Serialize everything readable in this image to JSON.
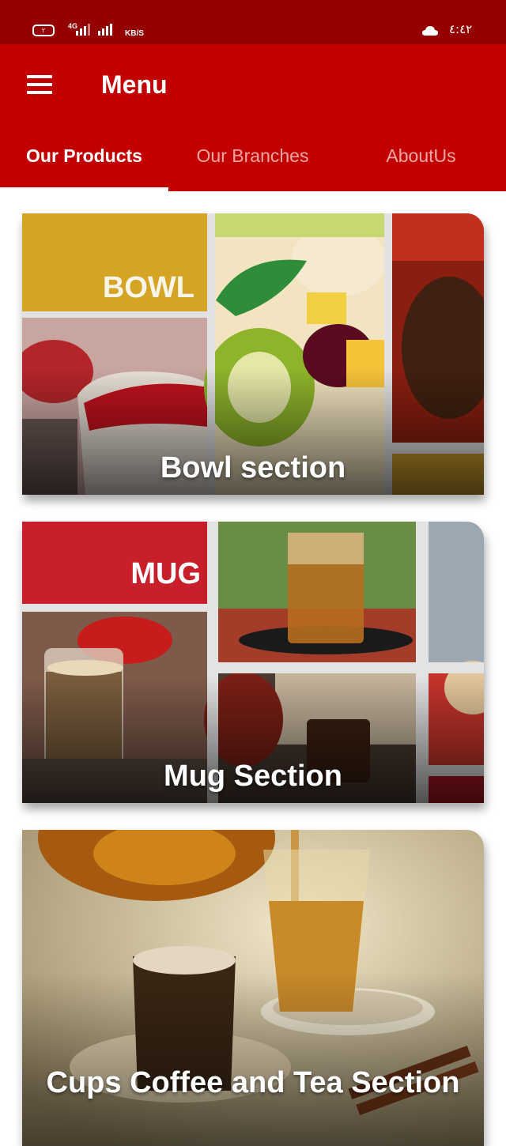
{
  "status_bar": {
    "battery": "٢",
    "network": "4G",
    "speed_unit": "KB/S",
    "time": "٤:٤٢",
    "icons": [
      "battery-icon",
      "signal-icon",
      "cloud-icon"
    ]
  },
  "app_bar": {
    "title": "Menu",
    "menu_icon": "hamburger-icon",
    "background": "#c30000"
  },
  "tabs": [
    {
      "label": "Our Products",
      "selected": true
    },
    {
      "label": "Our Branches",
      "selected": false
    },
    {
      "label": "AboutUs",
      "selected": false
    }
  ],
  "sections": [
    {
      "label": "Bowl section",
      "tile_text": "BOWL",
      "tile_color": "#d4a020"
    },
    {
      "label": "Mug Section",
      "tile_text": "MUG",
      "tile_color": "#c8202a"
    },
    {
      "label": "Cups Coffee and Tea Section"
    }
  ],
  "colors": {
    "status_bar": "#950001",
    "app_bar": "#c30000",
    "inactive_tab": "#f0a6a6",
    "active_tab": "#ffffff"
  }
}
